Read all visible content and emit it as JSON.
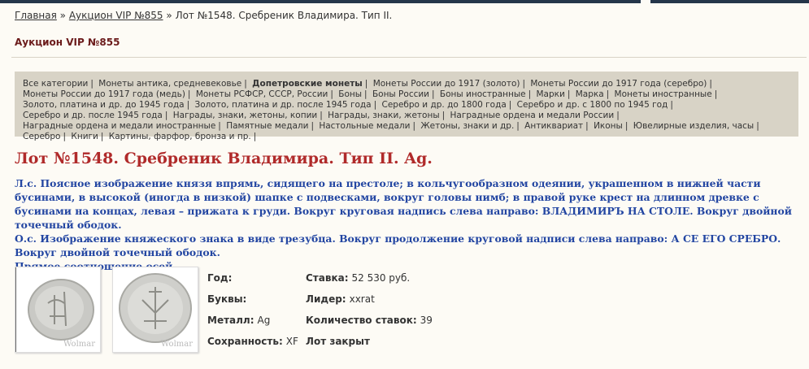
{
  "breadcrumb": {
    "home": "Главная",
    "sep1": "»",
    "auction": "Аукцион VIP №855",
    "sep2": "»",
    "current": "Лот №1548. Сребреник Владимира. Тип II."
  },
  "auction_title": "Аукцион VIP №855",
  "categories": [
    "Все категории",
    "Монеты антика, средневековье",
    "Допетровские монеты",
    "Монеты России до 1917 (золото)",
    "Монеты России до 1917 года (серебро)",
    "Монеты России до 1917 года (медь)",
    "Монеты РСФСР, СССР, России",
    "Боны",
    "Боны России",
    "Боны иностранные",
    "Марки",
    "Марка",
    "Монеты иностранные",
    "Золото, платина и др. до 1945 года",
    "Золото, платина и др. после 1945 года",
    "Серебро и др. до 1800 года",
    "Серебро и др. с 1800 по 1945 год",
    "Серебро и др. после 1945 года",
    "Награды, знаки, жетоны, копии",
    "Награды, знаки, жетоны",
    "Наградные ордена и медали России",
    "Наградные ордена и медали иностранные",
    "Памятные медали",
    "Настольные медали",
    "Жетоны, знаки и др.",
    "Антиквариат",
    "Иконы",
    "Ювелирные изделия, часы",
    "Серебро",
    "Книги",
    "Картины, фарфор, бронза и пр."
  ],
  "active_category": "Допетровские монеты",
  "lot_title": "Лот №1548.  Сребреник Владимира. Тип II. Ag.",
  "description": {
    "obverse": "Л.с. Поясное изображение князя впрямь, сидящего на престоле; в кольчугообразном одеянии, украшенном в нижней части бусинами, в высокой (иногда в низкой) шапке с подвесками, вокруг головы нимб; в правой руке крест на длинном древке с бусинами на концах, левая – прижата к груди. Вокруг круговая надпись слева направо: ВЛАДИМИРЪ НА СТОЛЕ. Вокруг двойной точечный ободок.",
    "reverse": "О.с. Изображение княжеского знака в виде трезубца. Вокруг продолжение круговой надписи слева направо: А СЕ ЕГО СРЕБРО. Вокруг двойной точечный ободок.",
    "axes": "Прямое соотношение осей"
  },
  "images": {
    "watermark": "Wolmar"
  },
  "details": {
    "year_label": "Год:",
    "year_value": "",
    "letters_label": "Буквы:",
    "letters_value": "",
    "metal_label": "Металл:",
    "metal_value": "Ag",
    "grade_label": "Сохранность:",
    "grade_value": "XF",
    "bid_label": "Ставка:",
    "bid_value": "52 530 руб.",
    "leader_label": "Лидер:",
    "leader_value": "xxrat",
    "bids_label": "Количество ставок:",
    "bids_value": "39",
    "status": "Лот закрыт"
  },
  "colors": {
    "accent": "#b02a2a",
    "description": "#2346a2",
    "panel": "#d8d3c6",
    "topbar": "#25364a"
  }
}
